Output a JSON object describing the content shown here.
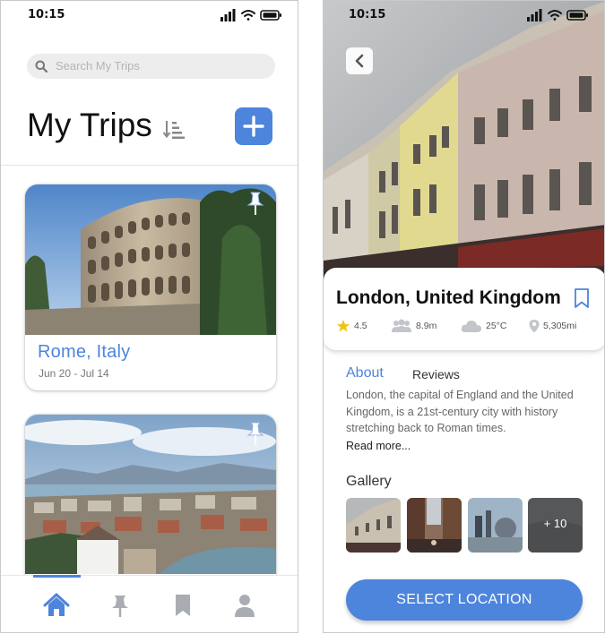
{
  "colors": {
    "accent": "#4d84dc",
    "muted_text": "#777777"
  },
  "left": {
    "status_time": "10:15",
    "search_placeholder": "Search My Trips",
    "title": "My Trips",
    "trips": [
      {
        "name": "Rome, Italy",
        "dates": "Jun 20 - Jul 14",
        "icon": "pin-icon"
      },
      {
        "name": "",
        "dates": "",
        "icon": "pin-icon"
      }
    ],
    "nav": [
      {
        "icon": "home-icon",
        "active": true
      },
      {
        "icon": "pin-icon",
        "active": false
      },
      {
        "icon": "bookmark-icon",
        "active": false
      },
      {
        "icon": "profile-icon",
        "active": false
      }
    ]
  },
  "right": {
    "status_time": "10:15",
    "city": "London, United Kingdom",
    "stats": {
      "rating": "4.5",
      "population": "8.9m",
      "temperature": "25°C",
      "distance": "5,305mi"
    },
    "tabs": {
      "about": "About",
      "reviews": "Reviews"
    },
    "about_text": "London, the capital of England and the United Kingdom, is a 21st-century city with history stretching back to Roman times.",
    "read_more": "Read more...",
    "gallery_title": "Gallery",
    "gallery_more": "+ 10",
    "select_button": "SELECT LOCATION"
  }
}
